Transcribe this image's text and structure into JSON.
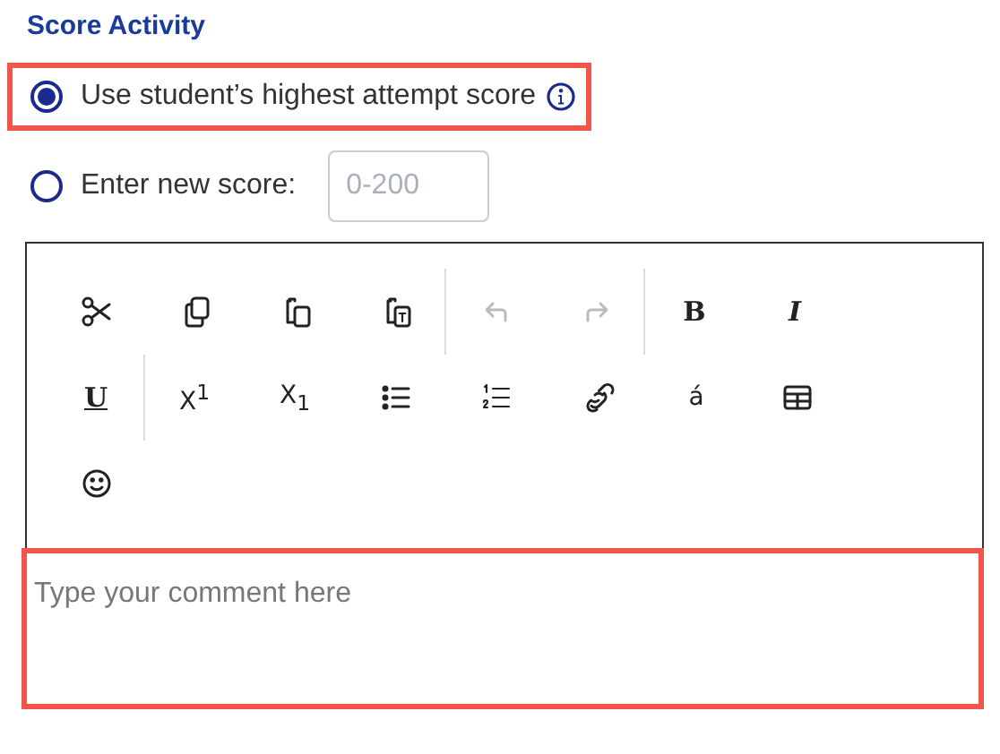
{
  "section_title": "Score Activity",
  "score_options": [
    {
      "label": "Use student’s highest attempt score",
      "selected": true,
      "highlighted": true,
      "info": true
    },
    {
      "label": "Enter new score:",
      "selected": false,
      "highlighted": false,
      "input": {
        "placeholder": "0-200"
      }
    }
  ],
  "toolbar": [
    {
      "kind": "cut",
      "disabled": false,
      "separator_before": false
    },
    {
      "kind": "copy",
      "disabled": false,
      "separator_before": false
    },
    {
      "kind": "paste",
      "disabled": false,
      "separator_before": false
    },
    {
      "kind": "paste-text",
      "disabled": false,
      "separator_before": false
    },
    {
      "kind": "undo",
      "disabled": true,
      "separator_before": true
    },
    {
      "kind": "redo",
      "disabled": true,
      "separator_before": false
    },
    {
      "kind": "bold",
      "label": "B",
      "disabled": false,
      "separator_before": true
    },
    {
      "kind": "italic",
      "label": "I",
      "disabled": false,
      "separator_before": false
    },
    {
      "kind": "underline",
      "label": "U",
      "disabled": false,
      "separator_before": false
    },
    {
      "kind": "superscript",
      "label": "X$^{1}$",
      "disabled": false,
      "separator_before": true
    },
    {
      "kind": "subscript",
      "label": "X$_{1}$",
      "disabled": false,
      "separator_before": false
    },
    {
      "kind": "bullet-list",
      "disabled": false,
      "separator_before": false
    },
    {
      "kind": "numbered-list",
      "disabled": false,
      "separator_before": false
    },
    {
      "kind": "link",
      "disabled": false,
      "separator_before": false
    },
    {
      "kind": "accent",
      "label": "á",
      "disabled": false,
      "separator_before": false
    },
    {
      "kind": "table",
      "disabled": false,
      "separator_before": false
    },
    {
      "kind": "emoji",
      "disabled": false,
      "separator_before": false
    }
  ],
  "comment": {
    "placeholder": "Type your comment here",
    "highlighted": true
  }
}
